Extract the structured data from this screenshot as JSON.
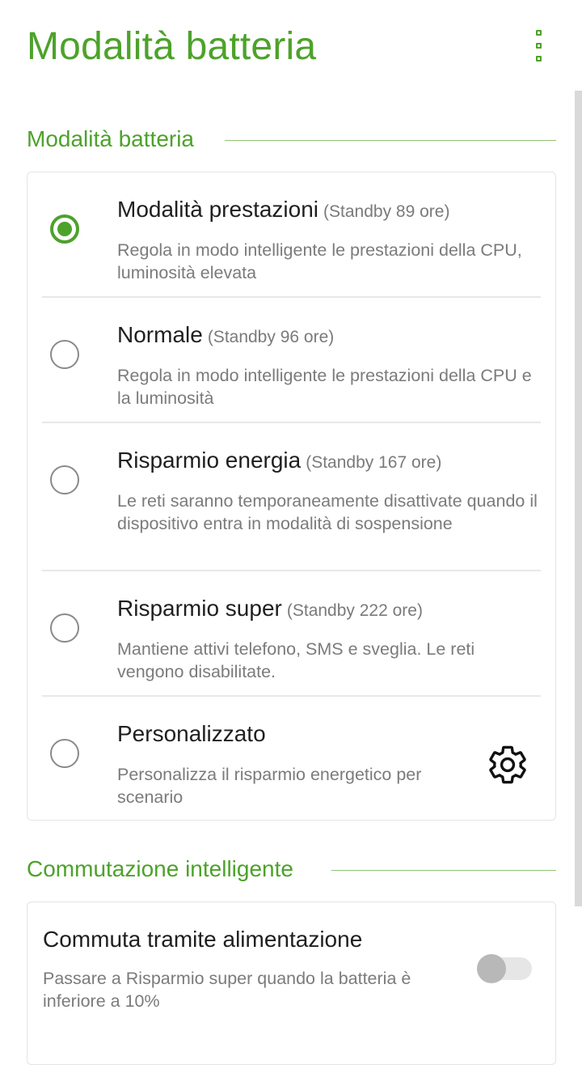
{
  "app_bar": {
    "title": "Modalità batteria",
    "menu_icon": "overflow-menu-icon"
  },
  "sections": {
    "battery_mode": {
      "header": "Modalità batteria"
    },
    "smart_switch": {
      "header": "Commutazione intelligente"
    }
  },
  "options": [
    {
      "title": "Modalità prestazioni",
      "standby": "(Standby 89 ore)",
      "description": "Regola in modo intelligente le prestazioni della CPU, luminosità elevata",
      "selected": true
    },
    {
      "title": "Normale",
      "standby": "(Standby 96 ore)",
      "description": "Regola in modo intelligente le prestazioni della CPU e la luminosità",
      "selected": false
    },
    {
      "title": "Risparmio energia",
      "standby": "(Standby 167 ore)",
      "description": "Le reti saranno temporaneamente disattivate quando il dispositivo entra in modalità di sospensione",
      "selected": false
    },
    {
      "title": "Risparmio super",
      "standby": "(Standby 222 ore)",
      "description": "Mantiene attivi telefono, SMS e sveglia. Le reti vengono disabilitate.",
      "selected": false
    },
    {
      "title": "Personalizzato",
      "standby": "",
      "description": "Personalizza il risparmio energetico per scenario",
      "selected": false,
      "icon": "gear-icon"
    }
  ],
  "power_switch": {
    "title": "Commuta tramite alimentazione",
    "description": "Passare a Risparmio super quando la batteria è inferiore a 10%",
    "enabled": false
  },
  "colors": {
    "accent": "#4CA22A",
    "secondary_text": "#7b7b7b"
  }
}
